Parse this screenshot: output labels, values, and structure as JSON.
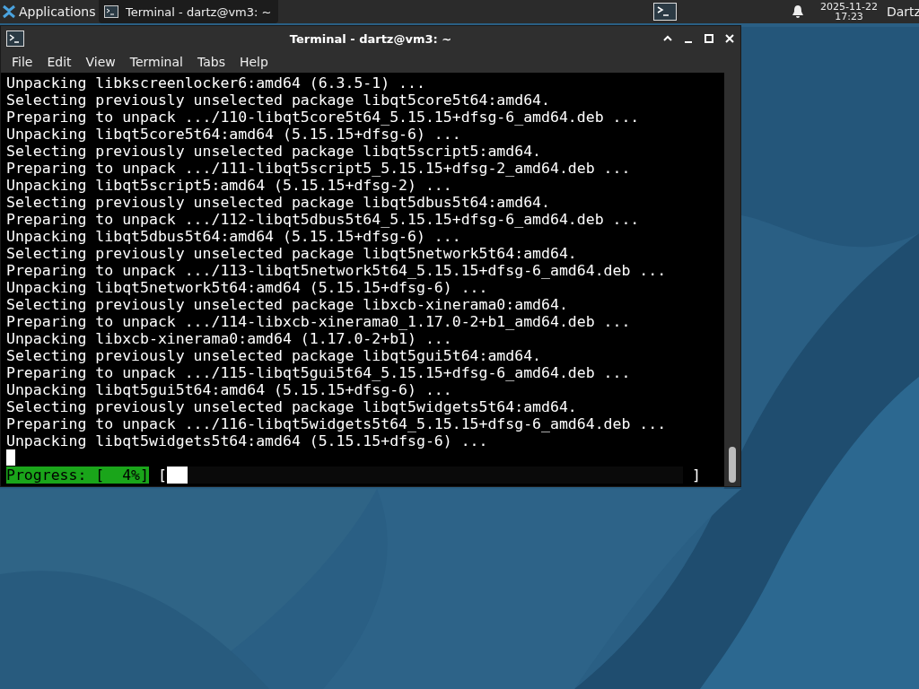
{
  "panel": {
    "apps_menu": {
      "label": "Applications"
    },
    "tasks": [
      {
        "label": "Terminal - dartz@vm3: ~",
        "selected": true
      }
    ],
    "clock": {
      "date": "2025-11-22",
      "time": "17:23"
    },
    "user": {
      "label": "Dartz"
    }
  },
  "window": {
    "title": "Terminal - dartz@vm3: ~",
    "menu": [
      "File",
      "Edit",
      "View",
      "Terminal",
      "Tabs",
      "Help"
    ],
    "lines": [
      "Unpacking libkscreenlocker6:amd64 (6.3.5-1) ...",
      "Selecting previously unselected package libqt5core5t64:amd64.",
      "Preparing to unpack .../110-libqt5core5t64_5.15.15+dfsg-6_amd64.deb ...",
      "Unpacking libqt5core5t64:amd64 (5.15.15+dfsg-6) ...",
      "Selecting previously unselected package libqt5script5:amd64.",
      "Preparing to unpack .../111-libqt5script5_5.15.15+dfsg-2_amd64.deb ...",
      "Unpacking libqt5script5:amd64 (5.15.15+dfsg-2) ...",
      "Selecting previously unselected package libqt5dbus5t64:amd64.",
      "Preparing to unpack .../112-libqt5dbus5t64_5.15.15+dfsg-6_amd64.deb ...",
      "Unpacking libqt5dbus5t64:amd64 (5.15.15+dfsg-6) ...",
      "Selecting previously unselected package libqt5network5t64:amd64.",
      "Preparing to unpack .../113-libqt5network5t64_5.15.15+dfsg-6_amd64.deb ...",
      "Unpacking libqt5network5t64:amd64 (5.15.15+dfsg-6) ...",
      "Selecting previously unselected package libxcb-xinerama0:amd64.",
      "Preparing to unpack .../114-libxcb-xinerama0_1.17.0-2+b1_amd64.deb ...",
      "Unpacking libxcb-xinerama0:amd64 (1.17.0-2+b1) ...",
      "Selecting previously unselected package libqt5gui5t64:amd64.",
      "Preparing to unpack .../115-libqt5gui5t64_5.15.15+dfsg-6_amd64.deb ...",
      "Unpacking libqt5gui5t64:amd64 (5.15.15+dfsg-6) ...",
      "Selecting previously unselected package libqt5widgets5t64:amd64.",
      "Preparing to unpack .../116-libqt5widgets5t64_5.15.15+dfsg-6_amd64.deb ...",
      "Unpacking libqt5widgets5t64:amd64 (5.15.15+dfsg-6) ..."
    ],
    "progress": {
      "label": "Progress: [  4%]",
      "open": "[",
      "close": "]",
      "level": 0.04
    }
  }
}
